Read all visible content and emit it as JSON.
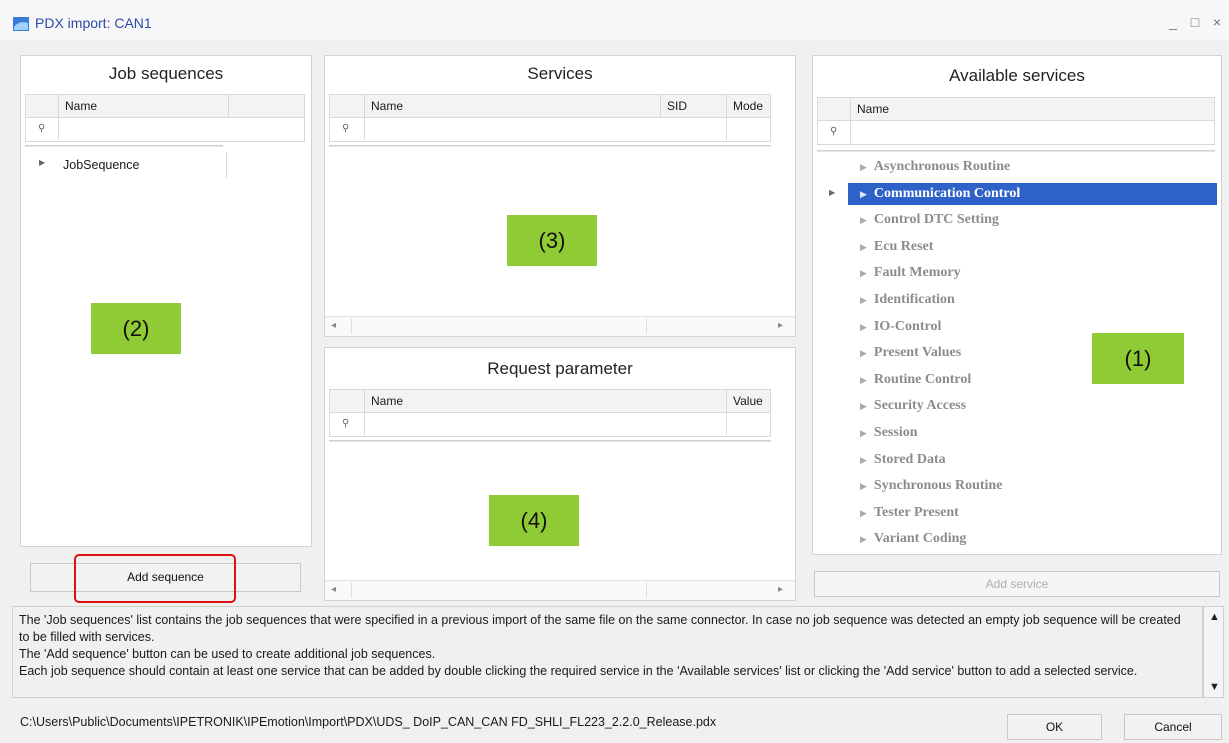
{
  "window": {
    "title": "PDX import: CAN1",
    "controls": [
      "_",
      "□",
      "×"
    ]
  },
  "job_sequences": {
    "title": "Job sequences",
    "columns": [
      "Name"
    ],
    "rows": [
      "JobSequence"
    ],
    "label": "(2)",
    "add_button": "Add sequence"
  },
  "services": {
    "title": "Services",
    "columns": [
      "Name",
      "SID",
      "Mode"
    ],
    "label": "(3)"
  },
  "request_parameter": {
    "title": "Request parameter",
    "columns": [
      "Name",
      "Value"
    ],
    "label": "(4)"
  },
  "available_services": {
    "title": "Available services",
    "columns": [
      "Name"
    ],
    "label": "(1)",
    "items": [
      "Asynchronous Routine",
      "Communication Control",
      "Control DTC Setting",
      "Ecu Reset",
      "Fault Memory",
      "Identification",
      "IO-Control",
      "Present Values",
      "Routine Control",
      "Security Access",
      "Session",
      "Stored Data",
      "Synchronous Routine",
      "Tester Present",
      "Variant Coding"
    ],
    "selected_item": "Communication Control",
    "add_button": "Add service"
  },
  "info": {
    "lines": [
      "The 'Job sequences' list contains the job sequences that were specified in a previous import of the same file on the same connector. In case no job sequence was detected an empty job sequence will be created to be filled with services.",
      "The 'Add sequence' button can be used to create additional job sequences.",
      "Each job sequence should contain at least one service that can be added by double clicking the required service in the 'Available services' list or clicking the 'Add service' button to add a selected service."
    ]
  },
  "footer": {
    "path": "C:\\Users\\Public\\Documents\\IPETRONIK\\IPEmotion\\Import\\PDX\\UDS_ DoIP_CAN_CAN FD_SHLI_FL223_2.2.0_Release.pdx",
    "ok": "OK",
    "cancel": "Cancel"
  }
}
